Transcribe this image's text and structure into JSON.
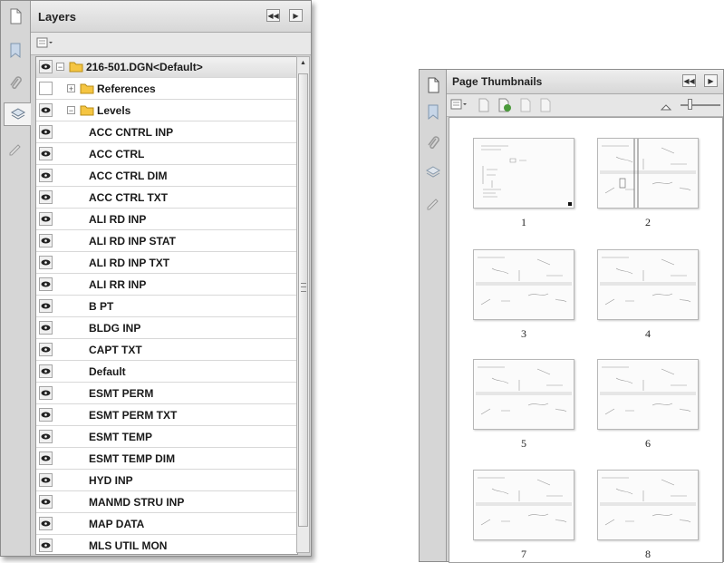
{
  "layers_panel": {
    "title": "Layers",
    "root_label": "216-501.DGN<Default>",
    "references_label": "References",
    "levels_label": "Levels",
    "levels": [
      "ACC CNTRL INP",
      "ACC CTRL",
      "ACC CTRL DIM",
      "ACC CTRL TXT",
      "ALI RD INP",
      "ALI RD INP STAT",
      "ALI RD INP TXT",
      "ALI RR INP",
      "B PT",
      "BLDG INP",
      "CAPT TXT",
      "Default",
      "ESMT PERM",
      "ESMT PERM TXT",
      "ESMT TEMP",
      "ESMT TEMP DIM",
      "HYD INP",
      "MANMD STRU INP",
      "MAP DATA",
      "MLS UTIL MON"
    ]
  },
  "thumbnails_panel": {
    "title": "Page Thumbnails",
    "pages": [
      "1",
      "2",
      "3",
      "4",
      "5",
      "6",
      "7",
      "8"
    ]
  },
  "colors": {
    "folder": "#f5c542",
    "panel_bg": "#d4d4d4",
    "list_bg": "#ffffff"
  },
  "icons": {
    "rail": [
      "pages-icon",
      "bookmark-icon",
      "attachment-icon",
      "layers-icon",
      "signature-icon"
    ],
    "header_buttons": [
      "collapse-icon",
      "options-menu-icon"
    ]
  }
}
